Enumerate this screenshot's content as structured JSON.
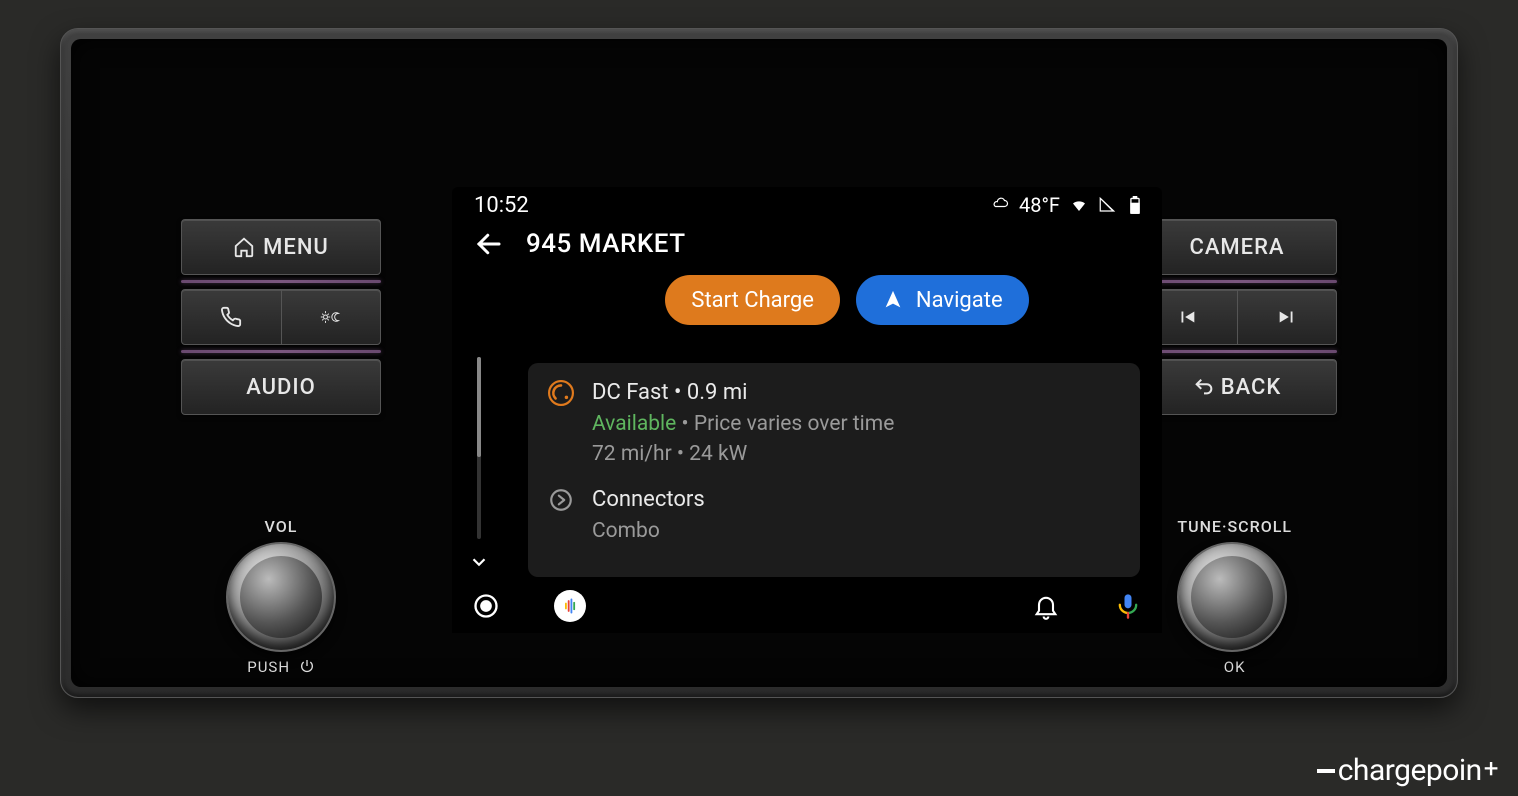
{
  "statusbar": {
    "time": "10:52",
    "temp": "48°F"
  },
  "header": {
    "title": "945 MARKET"
  },
  "actions": {
    "start_charge": "Start Charge",
    "navigate": "Navigate"
  },
  "station": {
    "title": "DC Fast • 0.9 mi",
    "status": "Available",
    "price": "Price varies over time",
    "rate": "72 mi/hr • 24 kW"
  },
  "connectors": {
    "label": "Connectors",
    "type": "Combo"
  },
  "physical": {
    "left": {
      "menu": "MENU",
      "audio": "AUDIO",
      "vol": "VOL",
      "push": "PUSH"
    },
    "right": {
      "camera": "CAMERA",
      "back": "BACK",
      "tune": "TUNE·SCROLL",
      "ok": "OK"
    }
  },
  "brand": {
    "name": "chargepoin",
    "suffix": "+"
  }
}
